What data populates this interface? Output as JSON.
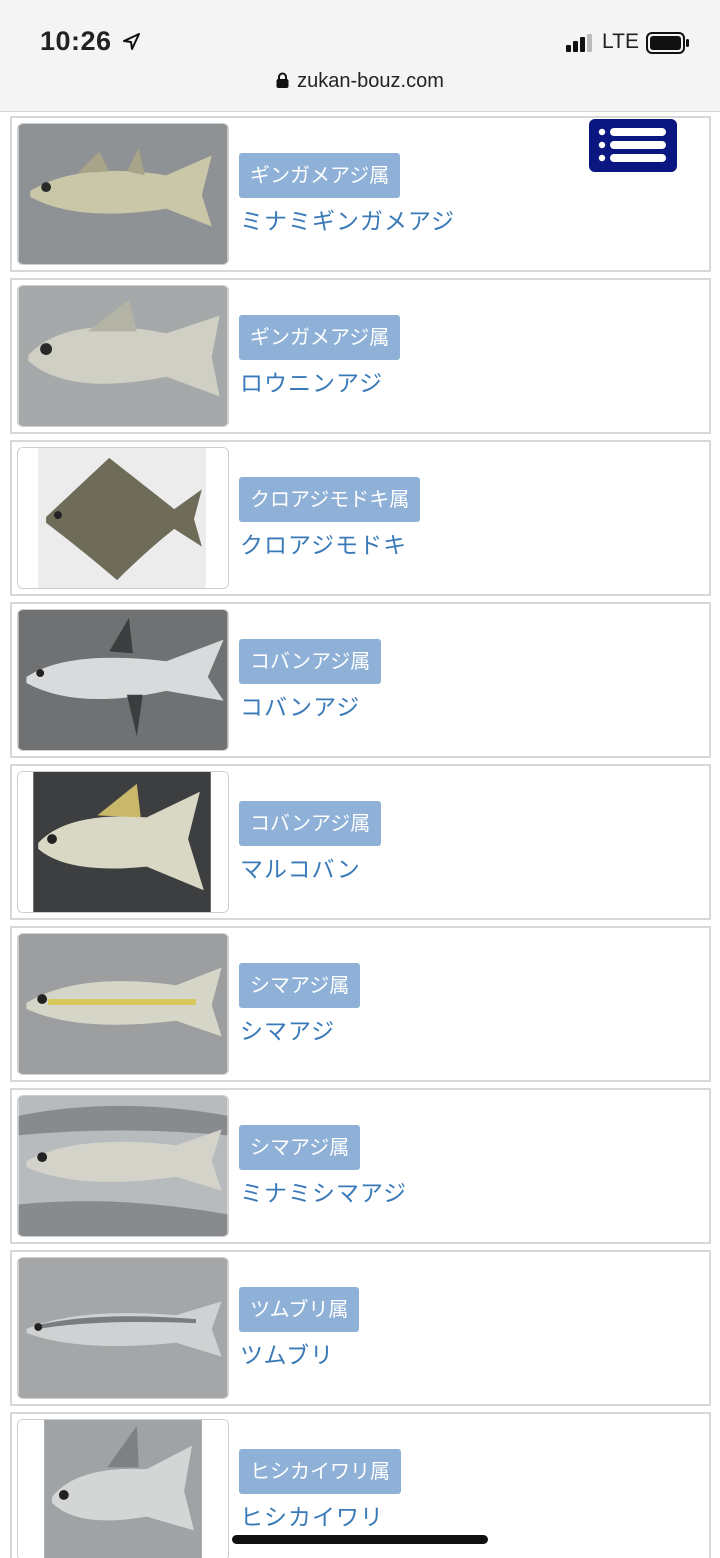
{
  "status": {
    "time": "10:26",
    "network": "LTE"
  },
  "browser": {
    "url": "zukan-bouz.com"
  },
  "menu": {
    "icon": "hamburger-menu-icon",
    "color": "#0b1780"
  },
  "colors": {
    "genus_badge": "#8fb1d7",
    "species_link": "#3a7ab8"
  },
  "items": [
    {
      "genus": "ギンガメアジ属",
      "name": "ミナミギンガメアジ"
    },
    {
      "genus": "ギンガメアジ属",
      "name": "ロウニンアジ"
    },
    {
      "genus": "クロアジモドキ属",
      "name": "クロアジモドキ"
    },
    {
      "genus": "コバンアジ属",
      "name": "コバンアジ"
    },
    {
      "genus": "コバンアジ属",
      "name": "マルコバン"
    },
    {
      "genus": "シマアジ属",
      "name": "シマアジ"
    },
    {
      "genus": "シマアジ属",
      "name": "ミナミシマアジ"
    },
    {
      "genus": "ツムブリ属",
      "name": "ツムブリ"
    },
    {
      "genus": "ヒシカイワリ属",
      "name": "ヒシカイワリ"
    }
  ]
}
